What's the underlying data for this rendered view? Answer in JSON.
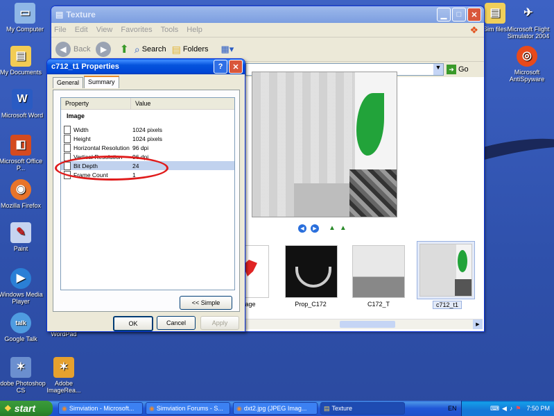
{
  "desktop": {
    "icons_left": [
      {
        "label": "My Computer",
        "glyph": "computer-icon"
      },
      {
        "label": "My Documents",
        "glyph": "folder-icon"
      },
      {
        "label": "Microsoft Word",
        "glyph": "W"
      },
      {
        "label": "Microsoft Office P...",
        "glyph": "office-icon"
      },
      {
        "label": "Mozilla Firefox",
        "glyph": "firefox-icon"
      },
      {
        "label": "Paint",
        "glyph": "paint-icon"
      },
      {
        "label": "Windows Media Player",
        "glyph": "media-icon"
      },
      {
        "label": "Google Talk",
        "glyph": "talk"
      },
      {
        "label": "Adobe Photoshop CS",
        "glyph": "photoshop-icon"
      }
    ],
    "icons_second": [
      {
        "label": "WordPad"
      },
      {
        "label": "Adobe ImageRea..."
      }
    ],
    "icons_right": [
      {
        "label": "Sim files"
      },
      {
        "label": "Microsoft Flight Simulator 2004"
      },
      {
        "label": "Microsoft AntiSpyware"
      }
    ]
  },
  "explorer": {
    "title": "Texture",
    "menu": [
      "File",
      "Edit",
      "View",
      "Favorites",
      "Tools",
      "Help"
    ],
    "toolbar": {
      "back": "Back",
      "search": "Search",
      "folders": "Folders"
    },
    "go": "Go",
    "thumbnails": [
      {
        "label": "age"
      },
      {
        "label": "Prop_C172"
      },
      {
        "label": "C172_T"
      },
      {
        "label": "c712_t1"
      }
    ]
  },
  "dialog": {
    "title": "c712_t1 Properties",
    "tabs": [
      "General",
      "Summary"
    ],
    "columns": [
      "Property",
      "Value"
    ],
    "section": "Image",
    "rows": [
      {
        "property": "Width",
        "value": "1024 pixels"
      },
      {
        "property": "Height",
        "value": "1024 pixels"
      },
      {
        "property": "Horizontal Resolution",
        "value": "96 dpi"
      },
      {
        "property": "Vertical Resolution",
        "value": "96 dpi"
      },
      {
        "property": "Bit Depth",
        "value": "24"
      },
      {
        "property": "Frame Count",
        "value": "1"
      }
    ],
    "simple_btn": "<< Simple",
    "ok": "OK",
    "cancel": "Cancel",
    "apply": "Apply"
  },
  "taskbar": {
    "start": "start",
    "items": [
      "Simviation - Microsoft...",
      "Simviation Forums - S...",
      "dxt2.jpg (JPEG Imag...",
      "Texture"
    ],
    "lang": "EN",
    "clock": "7:50 PM"
  },
  "colors": {
    "accent": "#0054e3",
    "highlight": "#e01b1b"
  }
}
